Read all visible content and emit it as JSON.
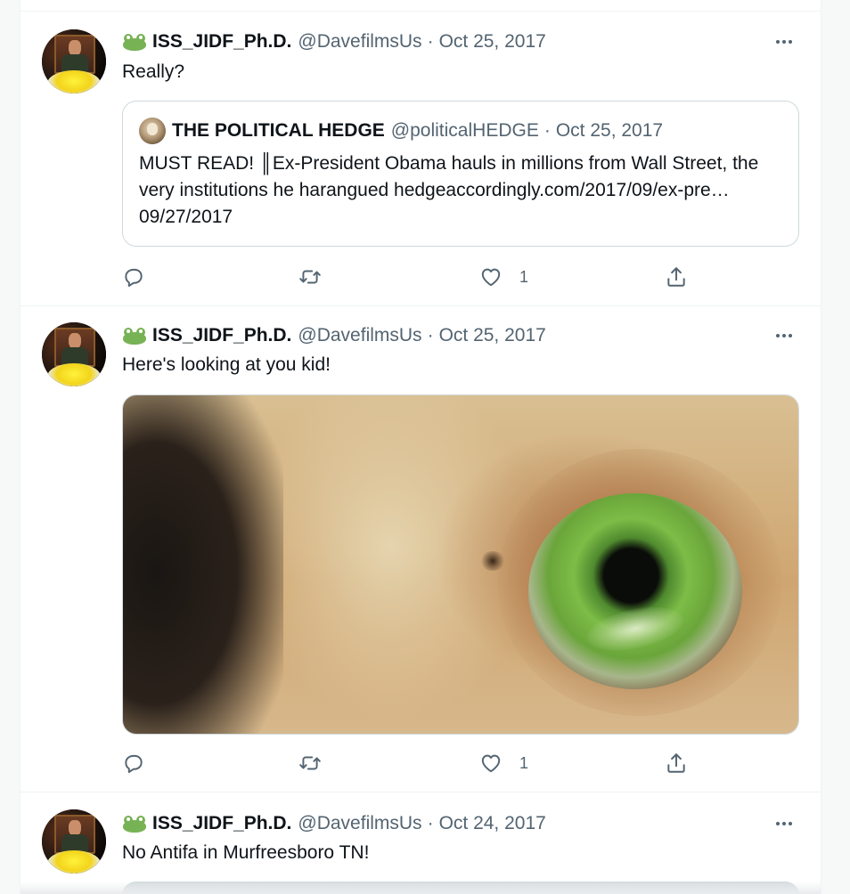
{
  "tweets": [
    {
      "display_name": "ISS_JIDF_Ph.D.",
      "handle": "@DavefilmsUs",
      "separator": "·",
      "date": "Oct 25, 2017",
      "text": "Really?",
      "quote": {
        "display_name": "THE POLITICAL HEDGE",
        "handle": "@politicalHEDGE",
        "separator": "·",
        "date": "Oct 25, 2017",
        "text": "MUST READ! ║Ex-President Obama hauls in millions from Wall Street, the very institutions he harangued hedgeaccordingly.com/2017/09/ex-pre… 09/27/2017"
      },
      "likes": "1"
    },
    {
      "display_name": "ISS_JIDF_Ph.D.",
      "handle": "@DavefilmsUs",
      "separator": "·",
      "date": "Oct 25, 2017",
      "text": "Here's looking at you kid!",
      "likes": "1"
    },
    {
      "display_name": "ISS_JIDF_Ph.D.",
      "handle": "@DavefilmsUs",
      "separator": "·",
      "date": "Oct 24, 2017",
      "text": "No Antifa in Murfreesboro TN!"
    }
  ],
  "icons": {
    "name_badge": "frog-emoji-icon",
    "more": "more-horizontal-icon",
    "reply": "reply-icon",
    "retweet": "retweet-icon",
    "like": "like-heart-icon",
    "share": "share-icon"
  },
  "colors": {
    "text_primary": "#0f1419",
    "text_secondary": "#536471",
    "border": "#cfd9de",
    "frog_green": "#77b255"
  }
}
